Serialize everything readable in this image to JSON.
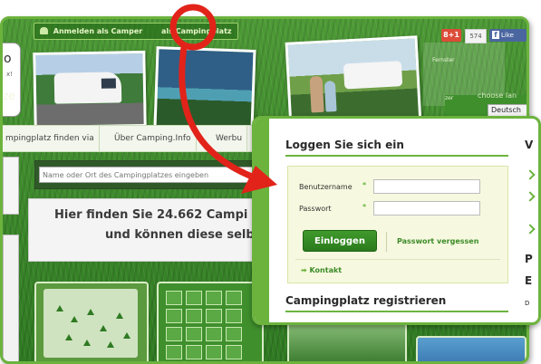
{
  "header": {
    "camper_login": "Anmelden als Camper",
    "camping_login": "als Campingplatz",
    "gplus_label": "8+1",
    "gplus_count": "574",
    "fb_like": "Like"
  },
  "logo": {
    "glyph": "o",
    "partial_text": "ze"
  },
  "language": {
    "choose_label": "choose lan",
    "selected": "Deutsch",
    "map_caption_1": "Fernster",
    "map_caption_2": "zer"
  },
  "nav": {
    "items": [
      "mpingplatz finden via",
      "Über Camping.Info",
      "Werbu"
    ]
  },
  "search": {
    "placeholder": "Name oder Ort des Campingplatzes eingeben"
  },
  "banner": {
    "line1": "Hier finden Sie 24.662 Campi",
    "line2": "und können diese selbs"
  },
  "login": {
    "title": "Loggen Sie sich ein",
    "username_label": "Benutzername",
    "password_label": "Passwort",
    "required_mark": "*",
    "login_button": "Einloggen",
    "forgot_link": "Passwort vergessen",
    "contact_link": "Kontakt",
    "arrow_glyph": "➡"
  },
  "register": {
    "title": "Campingplatz registrieren"
  },
  "right_partial": {
    "v": "V",
    "p": "P",
    "e": "E",
    "d": "D"
  },
  "colors": {
    "accent_green": "#6cb33e",
    "button_green": "#2b7a1c",
    "annotation_red": "#e2231a"
  },
  "icons": [
    "user-icon",
    "arrow-right-icon",
    "chevron-icon",
    "annotation-circle",
    "annotation-arrow"
  ]
}
